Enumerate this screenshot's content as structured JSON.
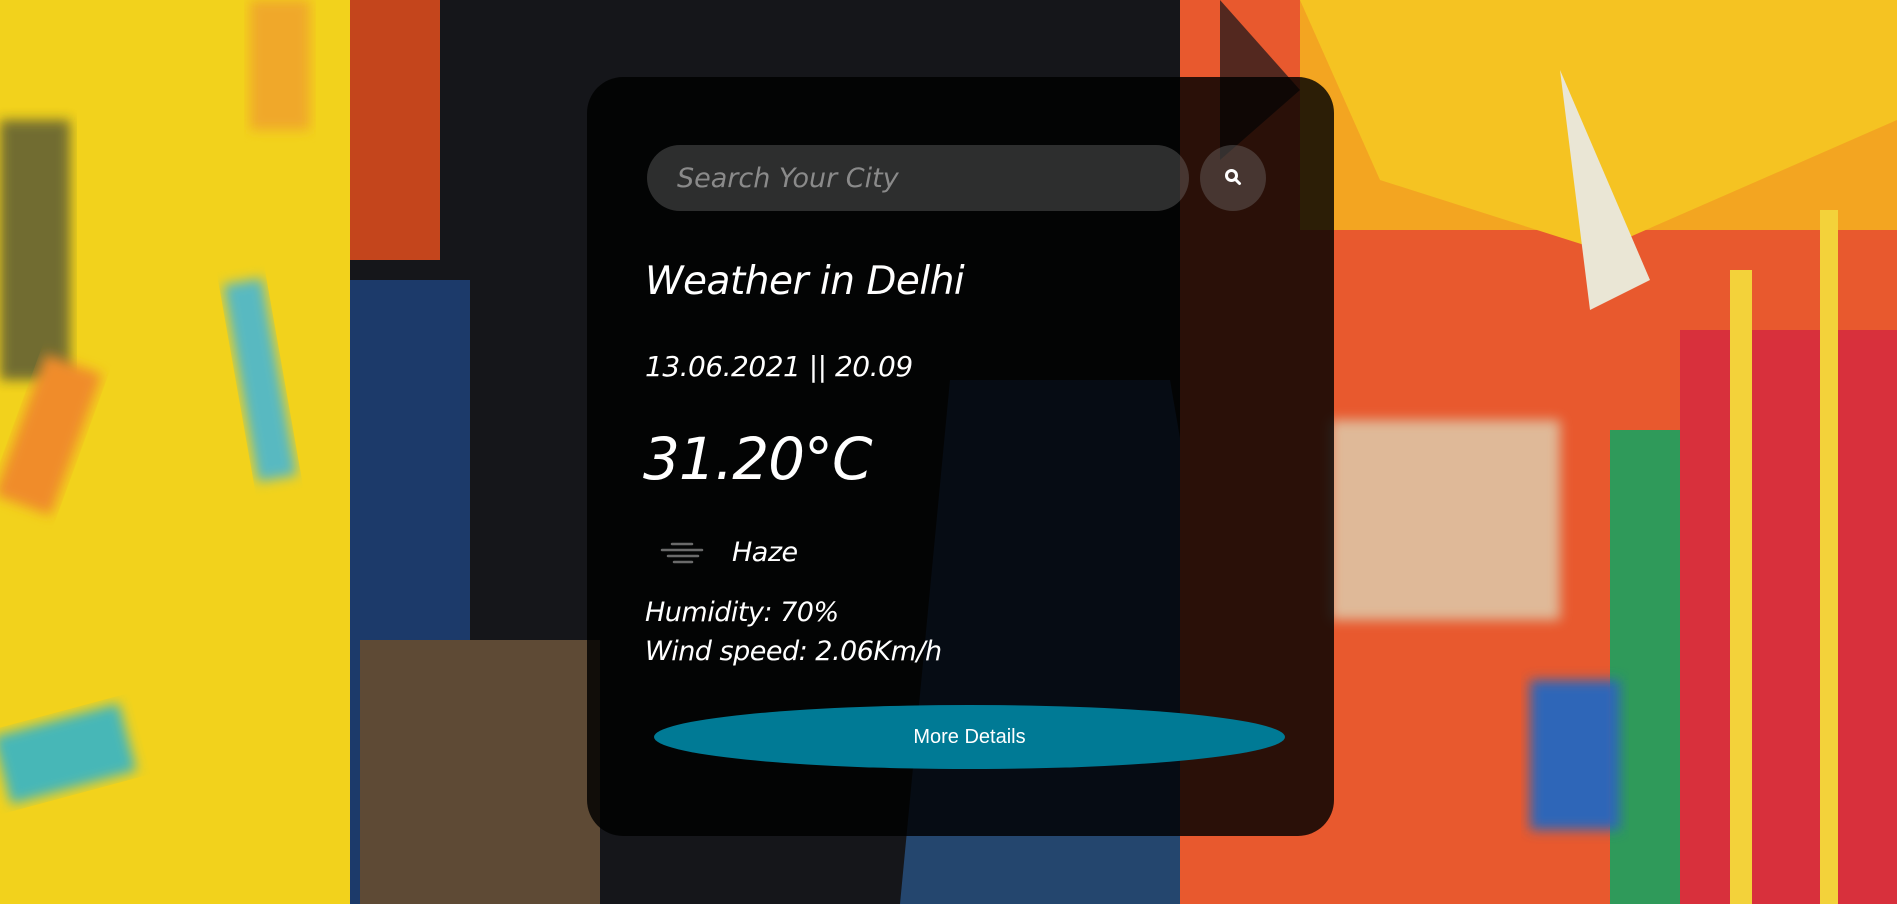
{
  "search": {
    "placeholder": "Search Your City",
    "value": "",
    "button_icon": "search-icon"
  },
  "weather": {
    "title": "Weather in Delhi",
    "datetime": "13.06.2021 || 20.09",
    "temperature": "31.20°C",
    "condition_icon": "haze-icon",
    "condition": "Haze",
    "humidity": "Humidity: 70%",
    "wind": "Wind speed: 2.06Km/h"
  },
  "actions": {
    "more_details_label": "More Details"
  },
  "colors": {
    "card_background": "#000000",
    "input_background": "#4a4a4a",
    "button_accent": "#007a95",
    "text": "#ffffff"
  }
}
